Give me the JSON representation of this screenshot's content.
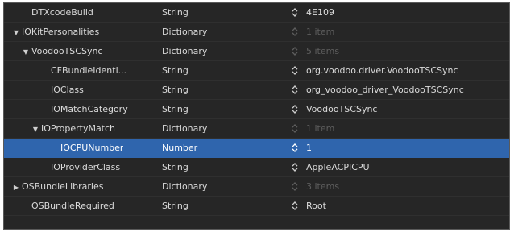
{
  "plist": {
    "rows": [
      {
        "key": "DTXcodeBuild",
        "type": "String",
        "value": "4E109",
        "indent": 2,
        "disclosure": "",
        "dim": false,
        "selected": false
      },
      {
        "key": "IOKitPersonalities",
        "type": "Dictionary",
        "value": "1 item",
        "indent": 1,
        "disclosure": "expanded",
        "dim": true,
        "selected": false
      },
      {
        "key": "VoodooTSCSync",
        "type": "Dictionary",
        "value": "5 items",
        "indent": 2,
        "disclosure": "expanded",
        "dim": true,
        "selected": false
      },
      {
        "key": "CFBundleIdenti...",
        "type": "String",
        "value": "org.voodoo.driver.VoodooTSCSync",
        "indent": 4,
        "disclosure": "",
        "dim": false,
        "selected": false
      },
      {
        "key": "IOClass",
        "type": "String",
        "value": "org_voodoo_driver_VoodooTSCSync",
        "indent": 4,
        "disclosure": "",
        "dim": false,
        "selected": false
      },
      {
        "key": "IOMatchCategory",
        "type": "String",
        "value": "VoodooTSCSync",
        "indent": 4,
        "disclosure": "",
        "dim": false,
        "selected": false
      },
      {
        "key": "IOPropertyMatch",
        "type": "Dictionary",
        "value": "1 item",
        "indent": 3,
        "disclosure": "expanded",
        "dim": true,
        "selected": false
      },
      {
        "key": "IOCPUNumber",
        "type": "Number",
        "value": "1",
        "indent": 5,
        "disclosure": "",
        "dim": false,
        "selected": true
      },
      {
        "key": "IOProviderClass",
        "type": "String",
        "value": "AppleACPICPU",
        "indent": 4,
        "disclosure": "",
        "dim": false,
        "selected": false
      },
      {
        "key": "OSBundleLibraries",
        "type": "Dictionary",
        "value": "3 items",
        "indent": 1,
        "disclosure": "collapsed",
        "dim": true,
        "selected": false
      },
      {
        "key": "OSBundleRequired",
        "type": "String",
        "value": "Root",
        "indent": 2,
        "disclosure": "",
        "dim": false,
        "selected": false
      }
    ],
    "icons": {
      "expanded": "disclosure-triangle-expanded-icon",
      "collapsed": "disclosure-triangle-collapsed-icon",
      "stepper": "up-down-stepper-icon"
    },
    "colors": {
      "background": "#262626",
      "selection": "#2f65ad",
      "text": "#dadada",
      "dim_text": "#5e5e5e"
    }
  }
}
